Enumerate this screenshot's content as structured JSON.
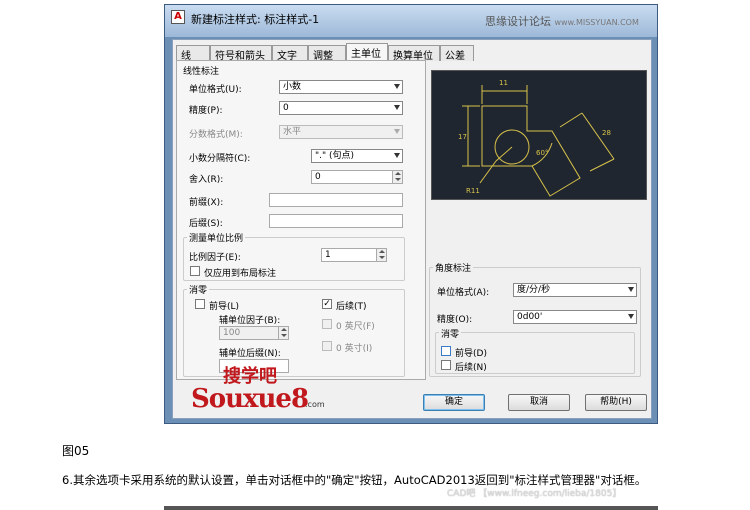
{
  "dialog": {
    "title": "新建标注样式: 标注样式-1",
    "watermark": "思缘设计论坛",
    "watermark_url": "www.MISSYUAN.COM"
  },
  "tabs": [
    "线",
    "符号和箭头",
    "文字",
    "调整",
    "主单位",
    "换算单位",
    "公差"
  ],
  "active_tab": "主单位",
  "linear": {
    "group_title": "线性标注",
    "unit_format_label": "单位格式(U):",
    "unit_format_value": "小数",
    "precision_label": "精度(P):",
    "precision_value": "0",
    "fraction_label": "分数格式(M):",
    "fraction_value": "水平",
    "decimal_sep_label": "小数分隔符(C):",
    "decimal_sep_value": "\".\" (句点)",
    "round_label": "舍入(R):",
    "round_value": "0",
    "prefix_label": "前缀(X):",
    "suffix_label": "后缀(S):"
  },
  "scale": {
    "group_title": "测量单位比例",
    "factor_label": "比例因子(E):",
    "factor_value": "1",
    "layout_only_label": "仅应用到布局标注"
  },
  "zero_linear": {
    "group_title": "消零",
    "leading_label": "前导(L)",
    "sub_factor_label": "辅单位因子(B):",
    "sub_factor_value": "100",
    "sub_suffix_label": "辅单位后缀(N):",
    "trailing_label": "后续(T)",
    "feet_label": "0 英尺(F)",
    "inch_label": "0 英寸(I)"
  },
  "angular": {
    "group_title": "角度标注",
    "unit_format_label": "单位格式(A):",
    "unit_format_value": "度/分/秒",
    "precision_label": "精度(O):",
    "precision_value": "0d00'",
    "zero_title": "消零",
    "leading_label": "前导(D)",
    "trailing_label": "后续(N)"
  },
  "preview": {
    "dims": [
      "11",
      "17",
      "28",
      "60°",
      "R11"
    ]
  },
  "buttons": {
    "ok": "确定",
    "cancel": "取消",
    "help": "帮助(H)"
  },
  "logo": {
    "cn": "搜学吧",
    "en": "Souxue8",
    "com": ".com"
  },
  "caption": "图05",
  "body_text": "6.其余选项卡采用系统的默认设置，单击对话框中的\"确定\"按钮，AutoCAD2013返回到\"标注样式管理器\"对话框。",
  "site_watermark": "CAD吧 【www.lfneeg.com/lieba/1805】",
  "colors": {
    "preview_bg": "#1f2630",
    "preview_lines": "#d8c24a",
    "logo_red": "#c0181d"
  }
}
